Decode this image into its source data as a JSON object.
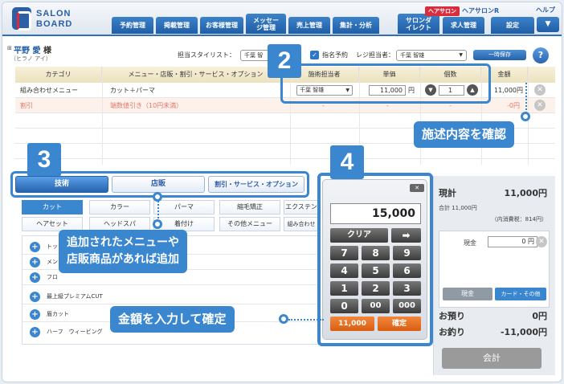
{
  "header": {
    "logo_line1": "SALON",
    "logo_line2": "BOARD",
    "brand_badge": "ヘアサロン",
    "brand_name": "ヘアサロンR",
    "help": "ヘルプ",
    "nav": [
      "予約管理",
      "掲載管理",
      "お客様管理",
      "メッセージ管理",
      "売上管理",
      "集計・分析",
      "サロンダイレクト",
      "求人管理",
      "設定"
    ],
    "menu_toggle": "▼"
  },
  "customer": {
    "name": "平野 愛",
    "honorific": "様",
    "kana": "（ヒラノ アイ）",
    "stylist_label": "担当スタイリスト：",
    "stylist_value": "千葉 智",
    "nominated_label": "指名予約",
    "register_label": "レジ担当者：",
    "register_value": "千葉 智雄",
    "save_button": "一時保存",
    "help_icon": "?"
  },
  "table": {
    "headers": [
      "カテゴリ",
      "メニュー・店販・割引・サービス・オプション",
      "施術担当者",
      "単価",
      "個数",
      "金額"
    ],
    "rows": [
      {
        "category": "組み合わせメニュー",
        "menu": "カット＋パーマ",
        "staff": "千葉 智雄",
        "price": "11,000",
        "unit": "円",
        "qty": "1",
        "amount": "11,000円"
      },
      {
        "category": "割引",
        "menu": "端数値引き（10円未満）",
        "staff": "-",
        "price": "-",
        "unit": "",
        "qty": "-",
        "amount": "-0円"
      }
    ]
  },
  "step2": {
    "number": "2",
    "callout": "施述内容を確認"
  },
  "step3": {
    "number": "3",
    "tabs": [
      "技術",
      "店販",
      "割引・サービス・オプション"
    ],
    "categories_row1": [
      "カット",
      "カラー",
      "パーマ",
      "縮毛矯正",
      "エクステン"
    ],
    "categories_row2": [
      "ヘアセット",
      "ヘッドスパ",
      "着付け",
      "その他メニュー",
      "組み合わせ"
    ],
    "list": [
      "トップ",
      "メン",
      "フロ",
      "最上級プレミアムCUT",
      "眉カット",
      "ハーフ　ウィービング"
    ],
    "callout_line1": "追加されたメニューや",
    "callout_line2": "店販商品があれば追加"
  },
  "step4": {
    "number": "4",
    "callout": "金額を入力して確定",
    "calc": {
      "close": "✕",
      "display": "15,000",
      "clear": "クリア",
      "arrow": "➡",
      "keys": [
        "7",
        "8",
        "9",
        "4",
        "5",
        "6",
        "1",
        "2",
        "3",
        "0",
        "00",
        "000"
      ],
      "preset": "11,000",
      "confirm": "確定"
    }
  },
  "summary": {
    "subtotal_label": "現計",
    "subtotal_value": "11,000円",
    "total_line": "合計 11,000円",
    "tax_line": "（内消費税：814円）",
    "cash_label": "現金",
    "cash_value": "0",
    "cash_unit": "円",
    "cash_button": "現金",
    "card_button": "カード・その他",
    "received_label": "お預り",
    "received_value": "0円",
    "change_label": "お釣り",
    "change_value": "-11,000円",
    "checkout_button": "会計"
  },
  "colors": {
    "accent": "#3a86cf",
    "nav": "#1f5ea6",
    "discount": "#e0786b",
    "confirm": "#d95f11"
  }
}
